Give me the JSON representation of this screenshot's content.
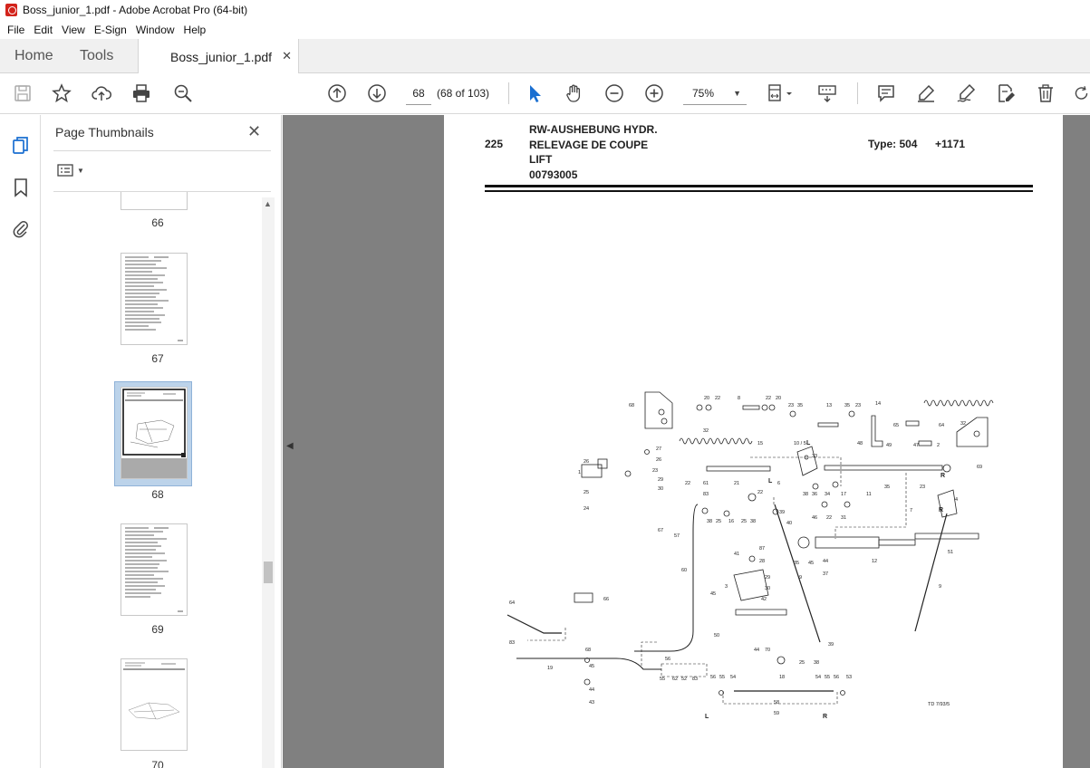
{
  "window": {
    "title": "Boss_junior_1.pdf - Adobe Acrobat Pro (64-bit)"
  },
  "menu": [
    "File",
    "Edit",
    "View",
    "E-Sign",
    "Window",
    "Help"
  ],
  "tabs": {
    "home": "Home",
    "tools": "Tools",
    "document": "Boss_junior_1.pdf"
  },
  "toolbar": {
    "page_current": "68",
    "page_of": "(68 of 103)",
    "zoom": "75%"
  },
  "thumbnails_panel": {
    "title": "Page Thumbnails",
    "pages": [
      {
        "label": "66"
      },
      {
        "label": "67"
      },
      {
        "label": "68",
        "selected": true
      },
      {
        "label": "69"
      },
      {
        "label": "70"
      }
    ]
  },
  "document_page": {
    "number": "225",
    "title_lines": [
      "RW-AUSHEBUNG HYDR.",
      "RELEVAGE DE COUPE",
      "LIFT",
      "00793005"
    ],
    "type_label": "Type: 504",
    "type_code": "+1171",
    "drawing_ref": "TD 7/93/5",
    "side_labels": {
      "left": "L",
      "right": "R"
    },
    "part_numbers": [
      "68",
      "20",
      "22",
      "8",
      "22",
      "20",
      "23",
      "35",
      "13",
      "35",
      "23",
      "14",
      "65",
      "64",
      "32",
      "32",
      "27",
      "26",
      "15",
      "10 / 5",
      "33",
      "48",
      "49",
      "47",
      "2",
      "69",
      "1",
      "25",
      "23",
      "22",
      "21",
      "29",
      "30",
      "61",
      "83",
      "38",
      "36",
      "34",
      "17",
      "11",
      "35",
      "23",
      "4",
      "7",
      "24",
      "22",
      "6",
      "39",
      "46",
      "22",
      "31",
      "57",
      "38",
      "25",
      "16",
      "25",
      "38",
      "40",
      "67",
      "87",
      "35",
      "44",
      "37",
      "12",
      "51",
      "41",
      "28",
      "60",
      "29",
      "30",
      "9",
      "9",
      "45",
      "3",
      "42",
      "66",
      "64",
      "50",
      "44",
      "70",
      "83",
      "25",
      "38",
      "39",
      "68",
      "45",
      "19",
      "56",
      "55",
      "62",
      "52",
      "83",
      "56",
      "55",
      "54",
      "18",
      "54",
      "55",
      "56",
      "53",
      "44",
      "43",
      "58",
      "59"
    ]
  }
}
